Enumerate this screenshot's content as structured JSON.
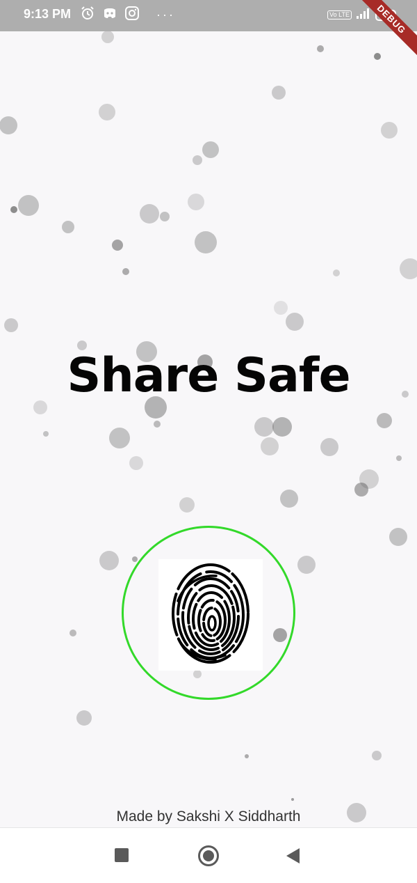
{
  "status_bar": {
    "time": "9:13 PM",
    "left_icons": [
      "alarm-icon",
      "discord-icon",
      "instagram-icon"
    ],
    "more": "···",
    "volte": "Vo LTE",
    "signal": "signal-icon",
    "battery": "100",
    "background": "#aeaeae"
  },
  "debug_banner": "DEBUG",
  "app": {
    "title": "Share Safe",
    "fingerprint_button": "fingerprint-icon",
    "ring_color": "#33d92a",
    "credits": "Made by Sakshi X Siddharth"
  },
  "nav_bar": {
    "recents": "square-icon",
    "home": "home-circle-icon",
    "back": "back-triangle-icon"
  }
}
